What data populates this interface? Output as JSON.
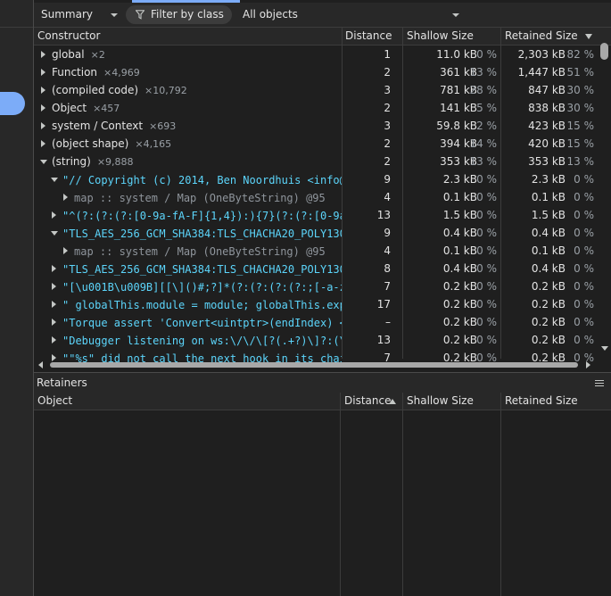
{
  "toolbar": {
    "view_select": "Summary",
    "filter_placeholder": "Filter by class",
    "scope_select": "All objects"
  },
  "columns": {
    "constructor": "Constructor",
    "distance": "Distance",
    "shallow": "Shallow Size",
    "retained": "Retained Size"
  },
  "rows": [
    {
      "kind": "group",
      "indent": 0,
      "expanded": false,
      "name": "global",
      "count": "×2",
      "distance": "1",
      "shallow": "11.0 kB",
      "shallow_pct": "0 %",
      "retained": "2,303 kB",
      "retained_pct": "82 %"
    },
    {
      "kind": "group",
      "indent": 0,
      "expanded": false,
      "name": "Function",
      "count": "×4,969",
      "distance": "2",
      "shallow": "361 kB",
      "shallow_pct": "13 %",
      "retained": "1,447 kB",
      "retained_pct": "51 %"
    },
    {
      "kind": "group",
      "indent": 0,
      "expanded": false,
      "name": "(compiled code)",
      "count": "×10,792",
      "distance": "3",
      "shallow": "781 kB",
      "shallow_pct": "28 %",
      "retained": "847 kB",
      "retained_pct": "30 %"
    },
    {
      "kind": "group",
      "indent": 0,
      "expanded": false,
      "name": "Object",
      "count": "×457",
      "distance": "2",
      "shallow": "141 kB",
      "shallow_pct": "5 %",
      "retained": "838 kB",
      "retained_pct": "30 %"
    },
    {
      "kind": "group",
      "indent": 0,
      "expanded": false,
      "name": "system / Context",
      "count": "×693",
      "distance": "3",
      "shallow": "59.8 kB",
      "shallow_pct": "2 %",
      "retained": "423 kB",
      "retained_pct": "15 %"
    },
    {
      "kind": "group",
      "indent": 0,
      "expanded": false,
      "name": "(object shape)",
      "count": "×4,165",
      "distance": "2",
      "shallow": "394 kB",
      "shallow_pct": "14 %",
      "retained": "420 kB",
      "retained_pct": "15 %"
    },
    {
      "kind": "group",
      "indent": 0,
      "expanded": true,
      "name": "(string)",
      "count": "×9,888",
      "distance": "2",
      "shallow": "353 kB",
      "shallow_pct": "13 %",
      "retained": "353 kB",
      "retained_pct": "13 %"
    },
    {
      "kind": "str",
      "indent": 1,
      "expanded": true,
      "name": "\"// Copyright (c) 2014, Ben Noordhuis <info@bnoo",
      "count": "",
      "distance": "9",
      "shallow": "2.3 kB",
      "shallow_pct": "0 %",
      "retained": "2.3 kB",
      "retained_pct": "0 %"
    },
    {
      "kind": "map",
      "indent": 2,
      "expanded": false,
      "name": "map :: system / Map (OneByteString) @95",
      "count": "",
      "distance": "4",
      "shallow": "0.1 kB",
      "shallow_pct": "0 %",
      "retained": "0.1 kB",
      "retained_pct": "0 %"
    },
    {
      "kind": "str",
      "indent": 1,
      "expanded": false,
      "name": "\"^(?:(?:(?:[0-9a-fA-F]{1,4}):){7}(?:(?:[0-9a-fA",
      "count": "",
      "distance": "13",
      "shallow": "1.5 kB",
      "shallow_pct": "0 %",
      "retained": "1.5 kB",
      "retained_pct": "0 %"
    },
    {
      "kind": "str",
      "indent": 1,
      "expanded": true,
      "name": "\"TLS_AES_256_GCM_SHA384:TLS_CHACHA20_POLY1305_SH",
      "count": "",
      "distance": "9",
      "shallow": "0.4 kB",
      "shallow_pct": "0 %",
      "retained": "0.4 kB",
      "retained_pct": "0 %"
    },
    {
      "kind": "map",
      "indent": 2,
      "expanded": false,
      "name": "map :: system / Map (OneByteString) @95",
      "count": "",
      "distance": "4",
      "shallow": "0.1 kB",
      "shallow_pct": "0 %",
      "retained": "0.1 kB",
      "retained_pct": "0 %"
    },
    {
      "kind": "str",
      "indent": 1,
      "expanded": false,
      "name": "\"TLS_AES_256_GCM_SHA384:TLS_CHACHA20_POLY1305_SH",
      "count": "",
      "distance": "8",
      "shallow": "0.4 kB",
      "shallow_pct": "0 %",
      "retained": "0.4 kB",
      "retained_pct": "0 %"
    },
    {
      "kind": "str",
      "indent": 1,
      "expanded": false,
      "name": "\"[\\u001B\\u009B][[\\]()#;?]*(?:(?:(?:(?:;[-a-zA-Z",
      "count": "",
      "distance": "7",
      "shallow": "0.2 kB",
      "shallow_pct": "0 %",
      "retained": "0.2 kB",
      "retained_pct": "0 %"
    },
    {
      "kind": "str",
      "indent": 1,
      "expanded": false,
      "name": "\" globalThis.module = module; globalThis.exports",
      "count": "",
      "distance": "17",
      "shallow": "0.2 kB",
      "shallow_pct": "0 %",
      "retained": "0.2 kB",
      "retained_pct": "0 %"
    },
    {
      "kind": "str",
      "indent": 1,
      "expanded": false,
      "name": "\"Torque assert 'Convert<uintptr>(endIndex) <= Co",
      "count": "",
      "distance": "–",
      "shallow": "0.2 kB",
      "shallow_pct": "0 %",
      "retained": "0.2 kB",
      "retained_pct": "0 %"
    },
    {
      "kind": "str",
      "indent": 1,
      "expanded": false,
      "name": "\"Debugger listening on ws:\\/\\/\\[?(.+?)\\]?:(\\d+)",
      "count": "",
      "distance": "13",
      "shallow": "0.2 kB",
      "shallow_pct": "0 %",
      "retained": "0.2 kB",
      "retained_pct": "0 %"
    },
    {
      "kind": "str",
      "indent": 1,
      "expanded": false,
      "name": "\"\"%s\" did not call the next hook in its chain a",
      "count": "",
      "distance": "7",
      "shallow": "0.2 kB",
      "shallow_pct": "0 %",
      "retained": "0.2 kB",
      "retained_pct": "0 %"
    }
  ],
  "retainers": {
    "title": "Retainers",
    "columns": {
      "object": "Object",
      "distance": "Distance",
      "shallow": "Shallow Size",
      "retained": "Retained Size"
    }
  },
  "icons": {
    "filter": "filter-icon",
    "sort_desc": "sort-descending-icon",
    "sort_asc": "sort-ascending-icon",
    "menu": "menu-icon"
  },
  "colors": {
    "accent": "#7cacf8",
    "string": "#5cd5fb",
    "background": "#1f1f1f"
  }
}
